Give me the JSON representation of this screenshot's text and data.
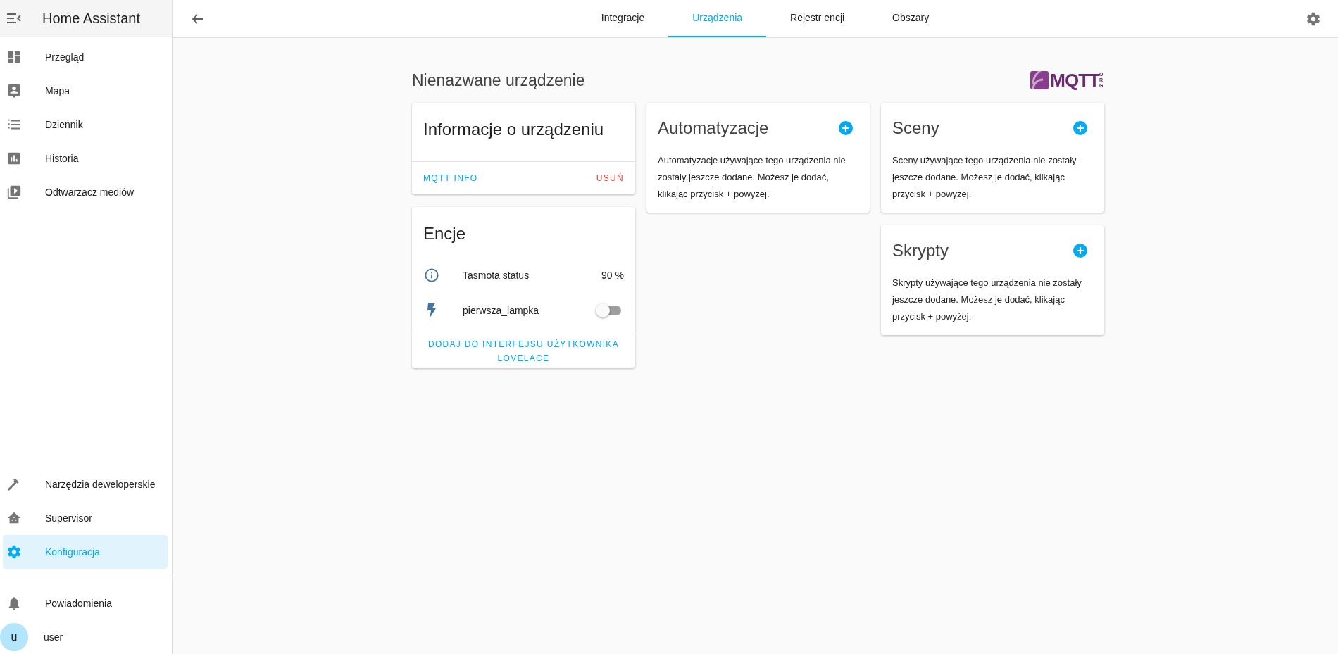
{
  "sidebar": {
    "title": "Home Assistant",
    "items": [
      {
        "label": "Przegląd",
        "selected": false
      },
      {
        "label": "Mapa",
        "selected": false
      },
      {
        "label": "Dziennik",
        "selected": false
      },
      {
        "label": "Historia",
        "selected": false
      },
      {
        "label": "Odtwarzacz mediów",
        "selected": false
      }
    ],
    "bottom_items": [
      {
        "label": "Narzędzia deweloperskie",
        "selected": false
      },
      {
        "label": "Supervisor",
        "selected": false
      },
      {
        "label": "Konfiguracja",
        "selected": true
      }
    ],
    "notifications": {
      "label": "Powiadomienia"
    },
    "user": {
      "initial": "u",
      "label": "user"
    }
  },
  "tabs": [
    {
      "label": "Integracje",
      "selected": false
    },
    {
      "label": "Urządzenia",
      "selected": true
    },
    {
      "label": "Rejestr encji",
      "selected": false
    },
    {
      "label": "Obszary",
      "selected": false
    }
  ],
  "device": {
    "title": "Nienazwane urządzenie",
    "logo": {
      "text": "MQTT",
      "suffix": "ORG"
    }
  },
  "info_card": {
    "title": "Informacje o urządzeniu",
    "actions": [
      {
        "label": "MQTT INFO",
        "kind": "primary"
      },
      {
        "label": "USUŃ",
        "kind": "danger"
      }
    ]
  },
  "entities_card": {
    "title": "Encje",
    "entities": [
      {
        "kind": "sensor",
        "name": "Tasmota status",
        "value": "90 %"
      },
      {
        "kind": "switch",
        "name": "pierwsza_lampka",
        "on": false
      }
    ],
    "action": "DODAJ DO INTERFEJSU UŻYTKOWNIKA LOVELACE"
  },
  "related_cards": [
    [
      {
        "title": "Automatyzacje",
        "text": "Automatyzacje używające tego urządzenia nie zostały jeszcze dodane. Możesz je dodać, klikając przycisk + powyżej."
      }
    ],
    [
      {
        "title": "Sceny",
        "text": "Sceny używające tego urządzenia nie zostały jeszcze dodane. Możesz je dodać, klikając przycisk + powyżej."
      },
      {
        "title": "Skrypty",
        "text": "Skrypty używające tego urządzenia nie zostały jeszcze dodane. Możesz je dodać, klikając przycisk + powyżej."
      }
    ]
  ]
}
